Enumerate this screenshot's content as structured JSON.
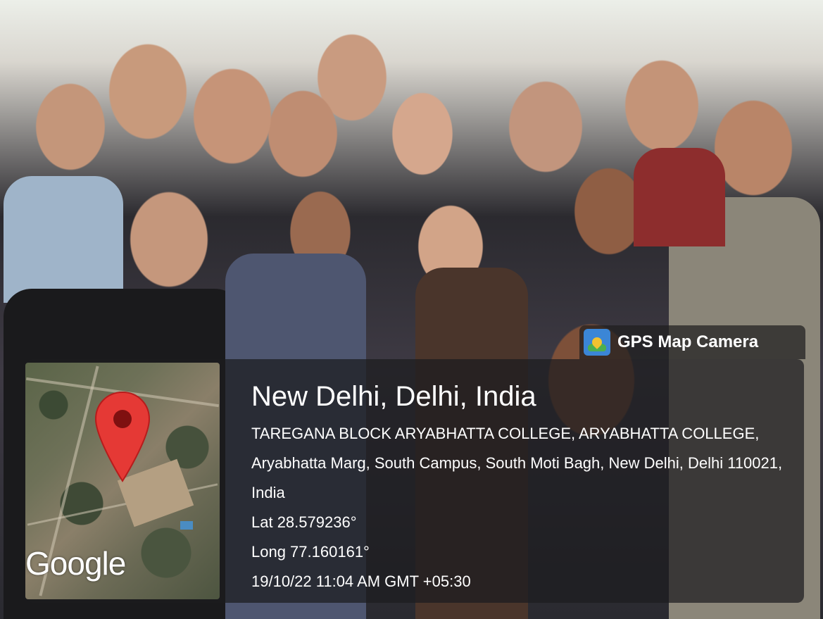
{
  "watermark": {
    "app_name": "GPS Map Camera",
    "icon": "gps-map-camera-icon"
  },
  "map": {
    "provider_label": "Google",
    "pin_icon": "map-pin-icon",
    "pin_color": "#e53935"
  },
  "location": {
    "city": "New Delhi, Delhi, India",
    "address": "TAREGANA BLOCK ARYABHATTA COLLEGE, ARYABHATTA COLLEGE, Aryabhatta Marg, South Campus, South Moti Bagh, New Delhi, Delhi 110021, India",
    "lat": "Lat 28.579236°",
    "long": "Long 77.160161°",
    "timestamp": "19/10/22 11:04 AM GMT +05:30"
  }
}
